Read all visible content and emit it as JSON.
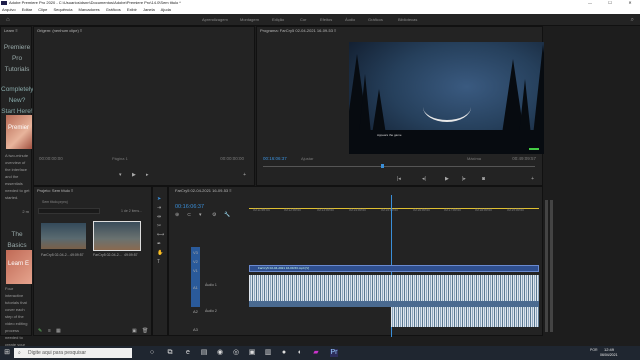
{
  "window": {
    "title": "Adobe Premiere Pro 2020 - C:\\Usuarios\\dsnn\\Documentos\\Adobe\\Premiere Pro\\14.0\\Sem titulo *",
    "minimize": "—",
    "maximize": "☐",
    "close": "✕"
  },
  "menu": [
    "Arquivo",
    "Editar",
    "Clipe",
    "Sequência",
    "Marcadores",
    "Gráficos",
    "Exibir",
    "Janela",
    "Ajuda"
  ],
  "workspaces": [
    "Aprendizagem",
    "Montagem",
    "Edição",
    "Cor",
    "Efeitos",
    "Áudio",
    "Gráficos",
    "Bibliotecas"
  ],
  "learn": {
    "header": "Learn ≡",
    "title": "Premiere Pro Tutorials",
    "intro": "Completely New? Start Here!",
    "item1_body": "A two-minute overview of the interface and the essentials needed to get started.",
    "item1_dur": "2 m",
    "section2": "The Basics",
    "item2_thumb": "Learn E",
    "item2_body": "Four interactive tutorials that cover each step of the video editing process needed to create your"
  },
  "source": {
    "header": "Origem: (nenhum clipe) ≡",
    "tc_left": "00:00:00:00",
    "tc_right": "00:00:00:00",
    "page": "Página 1"
  },
  "program": {
    "header": "Programa: FarCry5 02-04-2021 16-09-53 ≡",
    "tc_left": "00:16:06:37",
    "fit": "Ajustar",
    "quality": "Máxima",
    "tc_right": "00:49:09:57",
    "overlay": "Appears the game"
  },
  "project": {
    "header": "Projeto: Sem título ≡",
    "filename": "Sem titulo.prproj",
    "search_placeholder": "",
    "count": "1 de 2 itens...",
    "items": [
      {
        "name": "FarCry5 02-04-2...",
        "dur": "49:09:57"
      },
      {
        "name": "FarCry5 02-04-2...",
        "dur": "49:09:57"
      }
    ]
  },
  "timeline": {
    "header": "FarCry5 02-04-2021 16-09-53 ≡",
    "timecode": "00:16:06:37",
    "ruler": [
      "00:11:59:54",
      "00:12:59:50",
      "00:13:59:50",
      "00:14:59:50",
      "00:15:59:50",
      "00:16:59:50",
      "00:17:59:50",
      "00:18:59:50",
      "00:19:59:50"
    ],
    "video_tracks": [
      "V3",
      "V2",
      "V1"
    ],
    "audio_tracks": [
      "A1",
      "A2",
      "A3"
    ],
    "v1_clip": "FarCry5 02-04-2021 16-09-53.mp4 [V]",
    "a1_label": "Áudio 1",
    "a2_label": "Áudio 2",
    "meters_db": [
      "-6",
      "-12",
      "-18",
      "-24",
      "-30",
      "-36",
      "-42",
      "-48",
      "-54"
    ]
  },
  "taskbar": {
    "search_placeholder": "Digite aqui para pesquisar",
    "clock_time": "12:49",
    "clock_date": "06/04/2021",
    "lang": "POR"
  }
}
